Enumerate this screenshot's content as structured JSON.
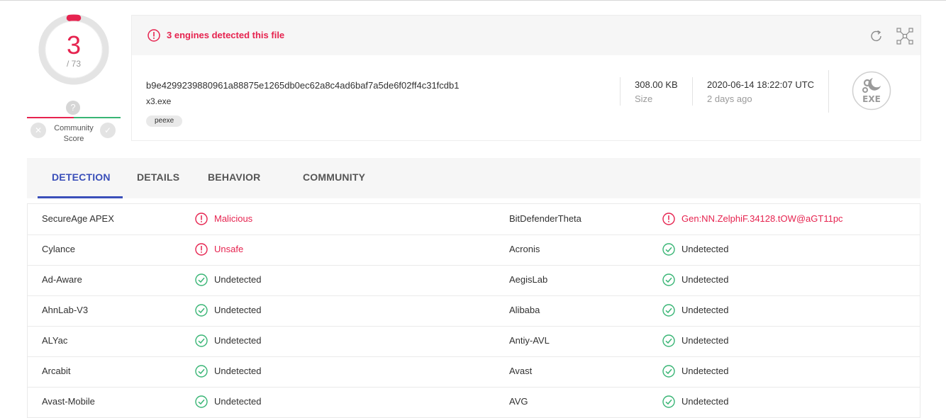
{
  "score": {
    "detected": "3",
    "total": "/ 73",
    "fraction": 0.041
  },
  "community": {
    "question": "?",
    "label_line1": "Community",
    "label_line2": "Score"
  },
  "header": {
    "alert": "3 engines detected this file",
    "hash": "b9e4299239880961a88875e1265db0ec62a8c4ad6baf7a5de6f02ff4c31fcdb1",
    "filename": "x3.exe",
    "tag": "peexe",
    "size_value": "308.00 KB",
    "size_label": "Size",
    "date_value": "2020-06-14 18:22:07 UTC",
    "date_label": "2 days ago",
    "filetype": "EXE"
  },
  "tabs": [
    {
      "label": "DETECTION",
      "active": true
    },
    {
      "label": "DETAILS",
      "active": false
    },
    {
      "label": "BEHAVIOR",
      "active": false
    },
    {
      "label": "COMMUNITY",
      "active": false
    }
  ],
  "detections": [
    {
      "left_engine": "SecureAge APEX",
      "left_result": "Malicious",
      "left_status": "malicious",
      "right_engine": "BitDefenderTheta",
      "right_result": "Gen:NN.ZelphiF.34128.tOW@aGT11pc",
      "right_status": "malicious"
    },
    {
      "left_engine": "Cylance",
      "left_result": "Unsafe",
      "left_status": "malicious",
      "right_engine": "Acronis",
      "right_result": "Undetected",
      "right_status": "clean"
    },
    {
      "left_engine": "Ad-Aware",
      "left_result": "Undetected",
      "left_status": "clean",
      "right_engine": "AegisLab",
      "right_result": "Undetected",
      "right_status": "clean"
    },
    {
      "left_engine": "AhnLab-V3",
      "left_result": "Undetected",
      "left_status": "clean",
      "right_engine": "Alibaba",
      "right_result": "Undetected",
      "right_status": "clean"
    },
    {
      "left_engine": "ALYac",
      "left_result": "Undetected",
      "left_status": "clean",
      "right_engine": "Antiy-AVL",
      "right_result": "Undetected",
      "right_status": "clean"
    },
    {
      "left_engine": "Arcabit",
      "left_result": "Undetected",
      "left_status": "clean",
      "right_engine": "Avast",
      "right_result": "Undetected",
      "right_status": "clean"
    },
    {
      "left_engine": "Avast-Mobile",
      "left_result": "Undetected",
      "left_status": "clean",
      "right_engine": "AVG",
      "right_result": "Undetected",
      "right_status": "clean"
    }
  ],
  "colors": {
    "malicious": "#e6234f",
    "clean": "#39b575",
    "accent": "#3a4fb9"
  },
  "icons": {
    "alert": "alert-circle-icon",
    "clean": "check-circle-icon",
    "reload": "reload-icon",
    "graph": "graph-icon",
    "filetype": "exe-file-icon"
  }
}
